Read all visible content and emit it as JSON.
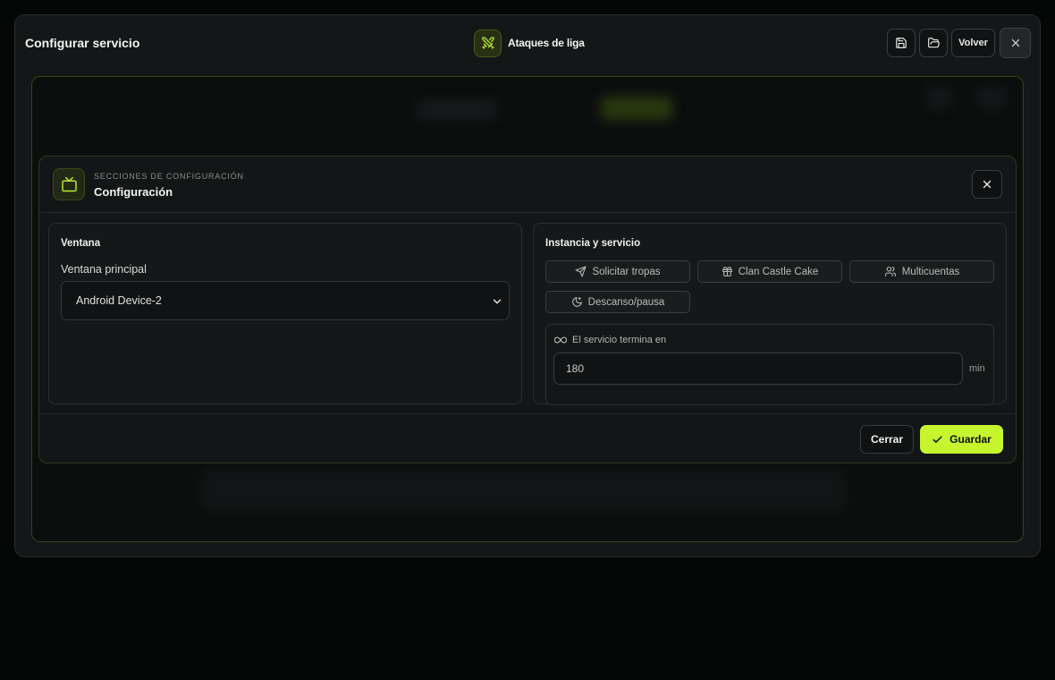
{
  "header": {
    "title": "Configurar servicio",
    "service_name": "Ataques de liga",
    "back_label": "Volver"
  },
  "modal": {
    "kicker": "Secciones de configuración",
    "title": "Configuración"
  },
  "window_panel": {
    "title": "Ventana",
    "field_label": "Ventana principal",
    "selected_value": "Android Device-2"
  },
  "instance_panel": {
    "title": "Instancia y servicio",
    "buttons": [
      {
        "label": "Solicitar tropas",
        "icon": "send-icon"
      },
      {
        "label": "Clan Castle Cake",
        "icon": "gift-icon"
      },
      {
        "label": "Multicuentas",
        "icon": "users-icon"
      },
      {
        "label": "Descanso/pausa",
        "icon": "moon-icon"
      }
    ],
    "end_label": "El servicio termina en",
    "end_value": "180",
    "end_unit": "min"
  },
  "footer": {
    "close_label": "Cerrar",
    "save_label": "Guardar"
  },
  "colors": {
    "accent": "#c6f52e",
    "background": "#050606",
    "panel": "#151718"
  }
}
